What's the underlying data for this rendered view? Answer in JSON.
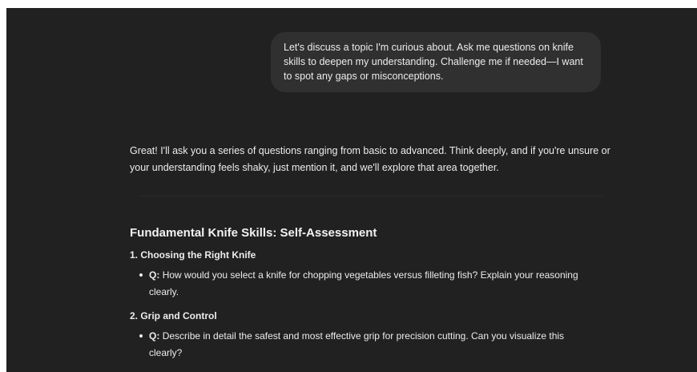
{
  "conversation": {
    "user_message": "Let's discuss a topic I'm curious about. Ask me questions on knife skills to deepen my understanding. Challenge me if needed—I want to spot any gaps or misconceptions.",
    "assistant": {
      "intro": "Great! I'll ask you a series of questions ranging from basic to advanced. Think deeply, and if you're unsure or your understanding feels shaky, just mention it, and we'll explore that area together.",
      "section_title": "Fundamental Knife Skills: Self-Assessment",
      "items": [
        {
          "heading": "1. Choosing the Right Knife",
          "q_label": "Q:",
          "question": "How would you select a knife for chopping vegetables versus filleting fish? Explain your reasoning clearly."
        },
        {
          "heading": "2. Grip and Control",
          "q_label": "Q:",
          "question": "Describe in detail the safest and most effective grip for precision cutting. Can you visualize this clearly?"
        }
      ]
    }
  }
}
